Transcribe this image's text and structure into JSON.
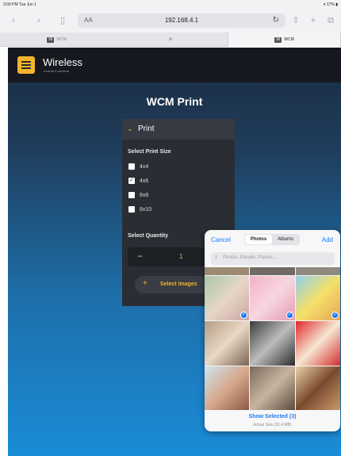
{
  "status": {
    "time": "3:00 PM  Tue Jun 1",
    "battery": "17%"
  },
  "browser": {
    "text_size": "AA",
    "url": "192.168.4.1",
    "tabs": [
      {
        "label": "WCM",
        "icon": "W"
      },
      {
        "label": "",
        "icon": ""
      },
      {
        "label": "WCM",
        "icon": "W"
      }
    ]
  },
  "app": {
    "logo": "Wireless",
    "logo_sub": "connect module",
    "page_title": "WCM Print",
    "panel_title": "Print",
    "print_size_label": "Select Print Size",
    "sizes": [
      {
        "label": "4x4",
        "checked": false
      },
      {
        "label": "4x6",
        "checked": true
      },
      {
        "label": "8x8",
        "checked": false
      },
      {
        "label": "8x10",
        "checked": false
      }
    ],
    "quantity_label": "Select Quantity",
    "quantity": "1",
    "select_images": "Select Images",
    "accent_color": "#f4b52c"
  },
  "picker": {
    "cancel": "Cancel",
    "add": "Add",
    "tabs": [
      "Photos",
      "Albums"
    ],
    "active_tab": "Photos",
    "search_placeholder": "Photos, People, Places...",
    "show_selected": "Show Selected (3)",
    "size_note": "Actual Size (31.4 MB)",
    "accent_color": "#1a7cf5"
  }
}
